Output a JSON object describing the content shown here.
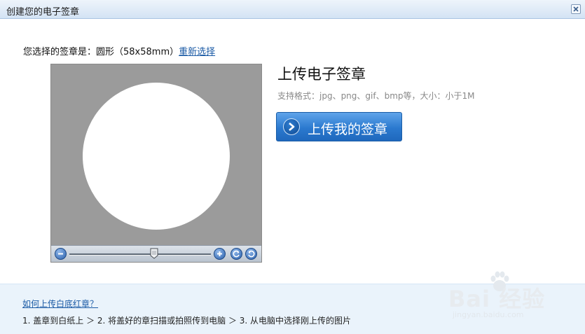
{
  "window": {
    "title": "创建您的电子签章"
  },
  "selection": {
    "prefix": "您选择的签章是：圆形（58x58mm）",
    "reselect_label": "重新选择"
  },
  "preview": {
    "shape": "circle",
    "zoom_level": 0.6,
    "icons": [
      "zoom-out-icon",
      "zoom-in-icon",
      "rotate-left-icon",
      "rotate-right-icon"
    ]
  },
  "upload": {
    "title": "上传电子签章",
    "formats": "支持格式：jpg、png、gif、bmp等，大小：小于1M",
    "button_label": "上传我的签章"
  },
  "help": {
    "link_label": "如何上传白底红章？",
    "steps": "1. 盖章到白纸上 ＞ 2. 将盖好的章扫描或拍照传到电脑 ＞ 3. 从电脑中选择刚上传的图片"
  },
  "watermark": {
    "brand": "Bai  经验",
    "url": "jingyan.baidu.com"
  },
  "colors": {
    "title_bar": "#d3e3f4",
    "preview_bg": "#9b9b9b",
    "button": "#2b79cf",
    "link": "#1a5aa5",
    "help_bg": "#eaf3fb"
  }
}
